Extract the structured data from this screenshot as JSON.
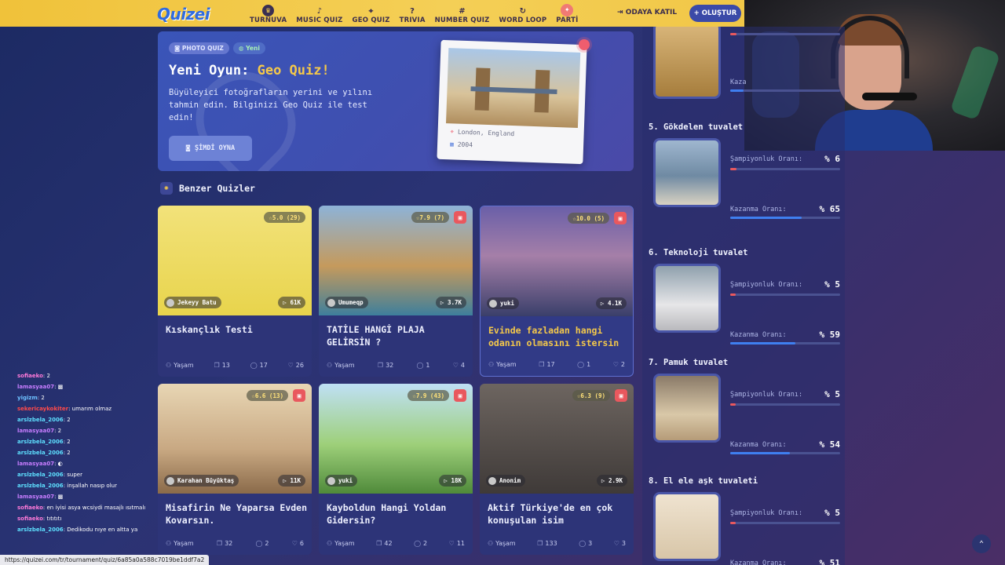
{
  "nav": {
    "logo": "Quizei",
    "items": [
      {
        "label": "TURNUVA",
        "icon": "trophy-icon",
        "glyph": "♛"
      },
      {
        "label": "MUSIC QUIZ",
        "icon": "music-icon",
        "glyph": "♪"
      },
      {
        "label": "GEO QUIZ",
        "icon": "map-pin-icon",
        "glyph": "⌖"
      },
      {
        "label": "TRIVIA",
        "icon": "question-icon",
        "glyph": "?"
      },
      {
        "label": "NUMBER QUIZ",
        "icon": "hash-icon",
        "glyph": "#"
      },
      {
        "label": "WORD LOOP",
        "icon": "loop-icon",
        "glyph": "↻"
      },
      {
        "label": "PARTİ",
        "icon": "party-icon",
        "glyph": "✦"
      }
    ],
    "join": "ODAYA KATIL",
    "create": "OLUŞTUR"
  },
  "hero": {
    "chip_photo": "PHOTO QUIZ",
    "chip_new": "Yeni",
    "title_prefix": "Yeni Oyun: ",
    "title_highlight": "Geo Quiz!",
    "description": "Büyüleyici fotoğrafların yerini ve yılını tahmin edin. Bilginizi Geo Quiz ile test edin!",
    "button": "ŞİMDİ OYNA",
    "photo_location": "London, England",
    "photo_year": "2004"
  },
  "section_title": "Benzer Quizler",
  "cards": [
    {
      "title": "Kıskançlık Testi",
      "rating": "5.0 (29)",
      "author": "Jekeyy Batu",
      "plays": "61K",
      "category": "Yaşam",
      "questions": "13",
      "comments": "17",
      "likes": "26",
      "fav": false
    },
    {
      "title": "TATİLE HANGİ PLAJA GELİRSİN ?",
      "rating": "7.9 (7)",
      "author": "Umumeqp",
      "plays": "3.7K",
      "category": "Yaşam",
      "questions": "32",
      "comments": "1",
      "likes": "4",
      "fav": true
    },
    {
      "title": "Evinde fazladan hangi odanın olmasını istersin",
      "rating": "10.0 (5)",
      "author": "yuki",
      "plays": "4.1K",
      "category": "Yaşam",
      "questions": "17",
      "comments": "1",
      "likes": "2",
      "fav": true
    },
    {
      "title": "Misafirin Ne Yaparsa Evden Kovarsın.",
      "rating": "6.6 (13)",
      "author": "Karahan Büyüktaş",
      "plays": "11K",
      "category": "Yaşam",
      "questions": "32",
      "comments": "2",
      "likes": "6",
      "fav": true
    },
    {
      "title": "Kayboldun Hangi Yoldan Gidersin?",
      "rating": "7.9 (43)",
      "author": "yuki",
      "plays": "18K",
      "category": "Yaşam",
      "questions": "42",
      "comments": "2",
      "likes": "11",
      "fav": true
    },
    {
      "title": "Aktif Türkiye'de en çok konuşulan isim",
      "rating": "6.3 (9)",
      "author": "Anonim",
      "plays": "2.9K",
      "category": "Yaşam",
      "questions": "133",
      "comments": "3",
      "likes": "3",
      "fav": true
    }
  ],
  "leaderboard": {
    "champ_label": "Şampiyonluk Oranı:",
    "win_label": "Kazanma Oranı:",
    "partial_label": "Kaza",
    "items": [
      {
        "name": "5. Gökdelen tuvalet",
        "champ": "% 6",
        "win": "% 65",
        "champ_frac": 0.06,
        "win_frac": 0.65
      },
      {
        "name": "6. Teknoloji tuvalet",
        "champ": "% 5",
        "win": "% 59",
        "champ_frac": 0.05,
        "win_frac": 0.59
      },
      {
        "name": "7. Pamuk tuvalet",
        "champ": "% 5",
        "win": "% 54",
        "champ_frac": 0.05,
        "win_frac": 0.54
      },
      {
        "name": "8. El ele aşk tuvaleti",
        "champ": "% 5",
        "win": "% 51",
        "champ_frac": 0.05,
        "win_frac": 0.51
      }
    ]
  },
  "chat": [
    {
      "user": "sofiaeko",
      "msg": ": 2",
      "color": "#ff7ad9"
    },
    {
      "user": "lamasyaa07",
      "msg": ": ▩",
      "color": "#c77dff"
    },
    {
      "user": "yigizm",
      "msg": ": 2",
      "color": "#6ec1ff"
    },
    {
      "user": "sekericaykokiter",
      "msg": ": umarım olmaz",
      "color": "#ff4a4a"
    },
    {
      "user": "arslzbela_2006",
      "msg": ": 2",
      "color": "#5ee0ff"
    },
    {
      "user": "lamasyaa07",
      "msg": ": 2",
      "color": "#c77dff"
    },
    {
      "user": "arslzbela_2006",
      "msg": ": 2",
      "color": "#5ee0ff"
    },
    {
      "user": "arslzbela_2006",
      "msg": ": 2",
      "color": "#5ee0ff"
    },
    {
      "user": "lamasyaa07",
      "msg": ": ◐",
      "color": "#c77dff"
    },
    {
      "user": "arslzbela_2006",
      "msg": ": super",
      "color": "#5ee0ff"
    },
    {
      "user": "arslzbela_2006",
      "msg": ": inşallah nasıp olur",
      "color": "#5ee0ff"
    },
    {
      "user": "lamasyaa07",
      "msg": ": ▩",
      "color": "#c77dff"
    },
    {
      "user": "sofiaeko",
      "msg": ": en iyisi asya wcsiydi masajlı ısıtmalı",
      "color": "#ff7ad9"
    },
    {
      "user": "sofiaeko",
      "msg": ": tıtıtıtı",
      "color": "#ff7ad9"
    },
    {
      "user": "arslzbela_2006",
      "msg": ": Dedikodu nıye en altta ya",
      "color": "#5ee0ff"
    }
  ],
  "status_url": "https://quizei.com/tr/tournament/quiz/6a85a0a588c7019be1ddf7a2",
  "colors": {
    "accent": "#f4c84a",
    "nav_bg": "#f4cf56",
    "primary": "#3b4aa8",
    "fav": "#e9585e"
  }
}
